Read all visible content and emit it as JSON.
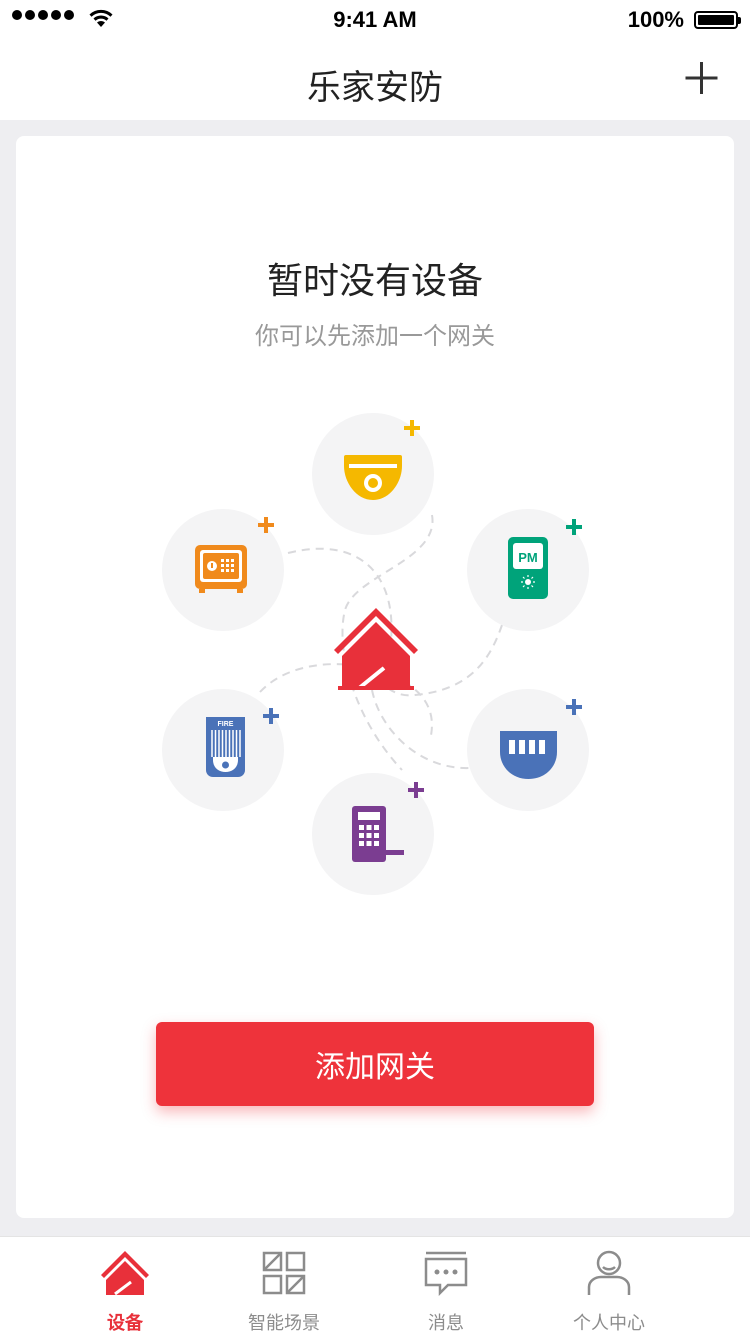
{
  "status_bar": {
    "time": "9:41 AM",
    "battery": "100%"
  },
  "nav": {
    "title": "乐家安防",
    "add_icon": "plus-icon"
  },
  "empty_state": {
    "title": "暂时没有设备",
    "subtitle": "你可以先添加一个网关"
  },
  "devices": [
    {
      "name": "camera-icon",
      "color": "#f5b800"
    },
    {
      "name": "safe-icon",
      "color": "#f08a1c"
    },
    {
      "name": "pm-sensor-icon",
      "color": "#00a37a",
      "label": "PM"
    },
    {
      "name": "fire-detector-icon",
      "color": "#4a72b8",
      "label": "FIRE"
    },
    {
      "name": "sensor-icon",
      "color": "#4a72b8"
    },
    {
      "name": "door-lock-icon",
      "color": "#7b3d91"
    }
  ],
  "center_icon": {
    "name": "home-icon",
    "color": "#e8303a"
  },
  "primary_button": {
    "label": "添加网关"
  },
  "tabs": [
    {
      "label": "设备",
      "icon": "home-icon",
      "active": true
    },
    {
      "label": "智能场景",
      "icon": "grid-icon",
      "active": false
    },
    {
      "label": "消息",
      "icon": "message-icon",
      "active": false
    },
    {
      "label": "个人中心",
      "icon": "user-icon",
      "active": false
    }
  ],
  "colors": {
    "accent": "#ee333b",
    "inactive": "#8c8c8c"
  }
}
